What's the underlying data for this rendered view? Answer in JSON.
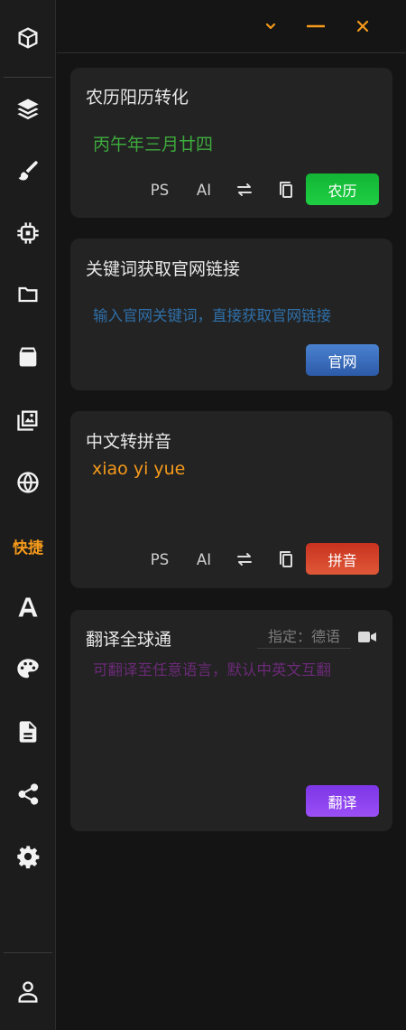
{
  "sidebar": {
    "items": [
      {
        "name": "cube-icon"
      },
      {
        "name": "layers-icon"
      },
      {
        "name": "brush-icon"
      },
      {
        "name": "chip-icon"
      },
      {
        "name": "folder-icon"
      },
      {
        "name": "box-icon"
      },
      {
        "name": "gallery-icon"
      },
      {
        "name": "globe-icon"
      },
      {
        "label": "快捷",
        "active": true
      },
      {
        "name": "font-icon"
      },
      {
        "name": "palette-icon"
      },
      {
        "name": "document-icon"
      },
      {
        "name": "share-icon"
      },
      {
        "name": "gear-icon"
      },
      {
        "name": "user-icon"
      }
    ],
    "active_label": "快捷"
  },
  "topbar": {
    "icons": [
      "chevron-down-icon",
      "minimize-icon",
      "close-icon"
    ],
    "accent": "#f59a1b"
  },
  "lunar_card": {
    "title": "农历阳历转化",
    "output": "丙午年三月廿四",
    "output_color": "#3daa3d",
    "ps_label": "PS",
    "ai_label": "AI",
    "button_label": "农历",
    "button_color": "#14c03a"
  },
  "link_card": {
    "title": "关键词获取官网链接",
    "placeholder": "输入官网关键词，直接获取官网链接",
    "placeholder_color": "#2f6fa8",
    "button_label": "官网",
    "button_color": "#3a6fc0"
  },
  "pinyin_card": {
    "title": "中文转拼音",
    "output": "xiao yi yue",
    "output_color": "#f59a1b",
    "ps_label": "PS",
    "ai_label": "AI",
    "button_label": "拼音",
    "button_color": "#d6402c"
  },
  "translate_card": {
    "title": "翻译全球通",
    "lang_placeholder": "指定：德语",
    "placeholder": "可翻译至任意语言，默认中英文互翻",
    "placeholder_color": "#6b2a78",
    "button_label": "翻译",
    "button_color": "#8a3ff0"
  }
}
